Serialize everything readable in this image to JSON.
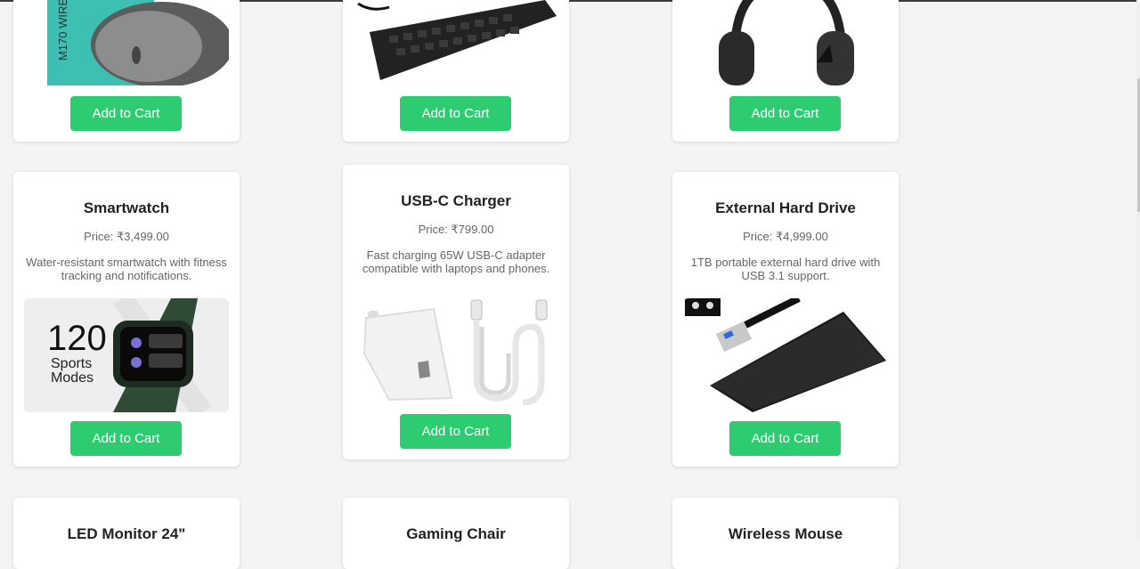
{
  "button_label": "Add to Cart",
  "brand_color": "#2ecc71",
  "top_row": [
    {
      "product_image": "wireless-mouse-photo",
      "mouse_box_text": "M170 WIRE"
    },
    {
      "product_image": "keyboard-photo"
    },
    {
      "product_image": "headphones-photo"
    }
  ],
  "middle_row": [
    {
      "name": "Smartwatch",
      "price": "Price: ₹3,499.00",
      "description": "Water-resistant smartwatch with fitness tracking and notifications.",
      "product_image": "smartwatch-photo",
      "promo_number": "120",
      "promo_line1": "Sports",
      "promo_line2": "Modes"
    },
    {
      "name": "USB-C Charger",
      "price": "Price: ₹799.00",
      "description": "Fast charging 65W USB-C adapter compatible with laptops and phones.",
      "product_image": "usb-c-charger-photo"
    },
    {
      "name": "External Hard Drive",
      "price": "Price: ₹4,999.00",
      "description": "1TB portable external hard drive with USB 3.1 support.",
      "product_image": "external-hard-drive-photo"
    }
  ],
  "bottom_row": [
    {
      "name": "LED Monitor 24\""
    },
    {
      "name": "Gaming Chair"
    },
    {
      "name": "Wireless Mouse"
    }
  ]
}
